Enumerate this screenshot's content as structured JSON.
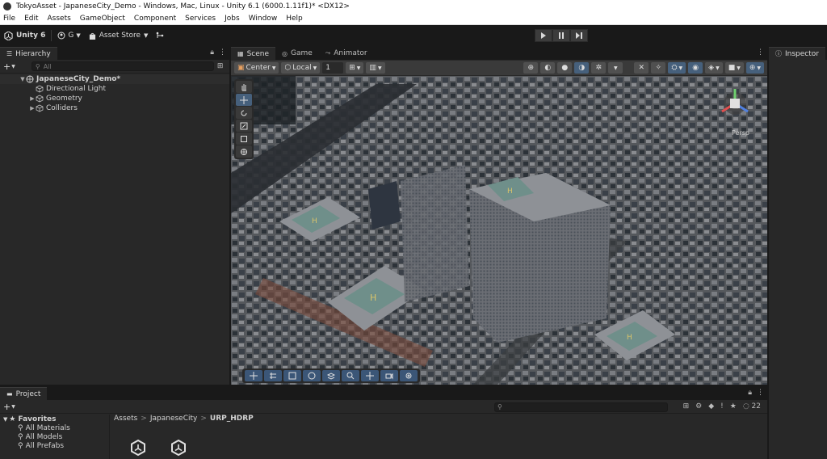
{
  "window": {
    "title": "TokyoAsset - JapaneseCity_Demo - Windows, Mac, Linux - Unity 6.1 (6000.1.11f1)* <DX12>"
  },
  "menu": [
    "File",
    "Edit",
    "Assets",
    "GameObject",
    "Component",
    "Services",
    "Jobs",
    "Window",
    "Help"
  ],
  "toolbar": {
    "unity_label": "Unity 6",
    "account_label": "G",
    "asset_store_label": "Asset Store"
  },
  "hierarchy": {
    "tab_label": "Hierarchy",
    "search_placeholder": "All",
    "scene_name": "JapaneseCity_Demo*",
    "items": [
      "Directional Light",
      "Geometry",
      "Colliders"
    ]
  },
  "scene": {
    "tabs": [
      "Scene",
      "Game",
      "Animator"
    ],
    "pivot_label": "Center",
    "space_label": "Local",
    "snap_value": "1",
    "view_label": "Persp"
  },
  "inspector": {
    "tab_label": "Inspector"
  },
  "project": {
    "tab_label": "Project",
    "favorites_label": "Favorites",
    "favorites": [
      "All Materials",
      "All Models",
      "All Prefabs"
    ],
    "breadcrumbs": [
      "Assets",
      "JapaneseCity",
      "URP_HDRP"
    ],
    "hidden_count": "22"
  },
  "colors": {
    "accent": "#46607c",
    "panel": "#282828",
    "chrome": "#191919"
  }
}
